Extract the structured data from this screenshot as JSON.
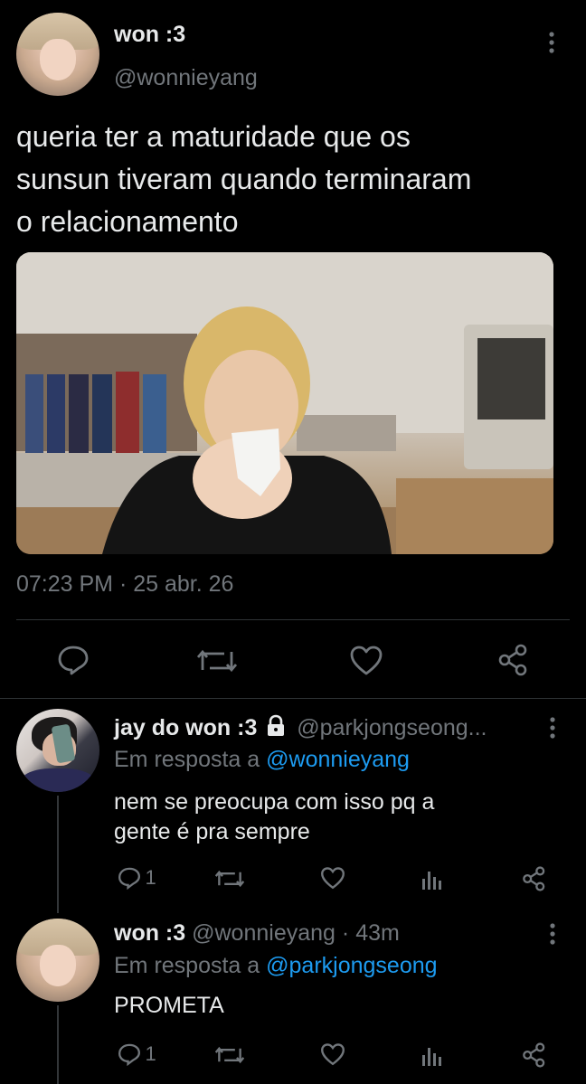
{
  "main_tweet": {
    "display_name": "won :3",
    "handle": "@wonnieyang",
    "text_line1": "queria ter a maturidade que os",
    "text_line2": "sunsun tiveram quando terminaram",
    "text_line3": "o relacionamento",
    "time": "07:23 PM",
    "separator": "·",
    "date": "25 abr. 26"
  },
  "reply1": {
    "display_name": "jay do won :3",
    "handle": "@parkjongseong...",
    "reply_prefix": "Em resposta a",
    "reply_to": "@wonnieyang",
    "text_line1": "nem se preocupa com isso pq a",
    "text_line2": "gente é pra sempre",
    "reply_count": "1"
  },
  "reply2": {
    "display_name": "won :3",
    "handle": "@wonnieyang",
    "separator": "·",
    "age": "43m",
    "reply_prefix": "Em resposta a",
    "reply_to": "@parkjongseong",
    "text": "PROMETA",
    "reply_count": "1"
  },
  "colors": {
    "background": "#000000",
    "text": "#e7e9ea",
    "muted": "#71767b",
    "link": "#1d9bf0",
    "divider": "#2f3336"
  },
  "icons": [
    "more-icon",
    "reply-icon",
    "retweet-icon",
    "like-icon",
    "share-icon",
    "lock-icon",
    "analytics-icon"
  ]
}
